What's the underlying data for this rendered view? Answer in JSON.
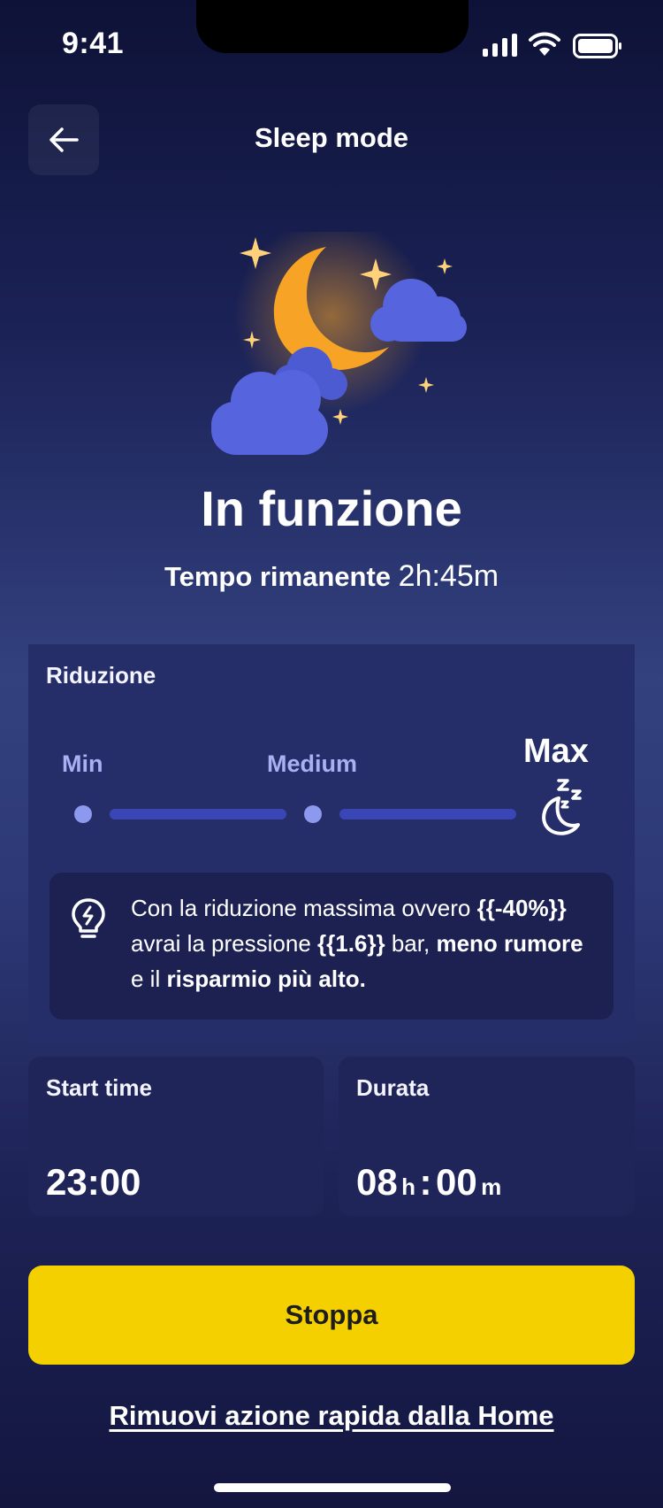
{
  "status_bar": {
    "time": "9:41"
  },
  "header": {
    "title": "Sleep mode"
  },
  "status": {
    "title": "In funzione",
    "remaining_label": "Tempo rimanente",
    "remaining_value": "2h:45m"
  },
  "reduction": {
    "label": "Riduzione",
    "levels": [
      "Min",
      "Medium",
      "Max"
    ],
    "selected_level": "Max",
    "tip": {
      "part1": "Con la riduzione massima ovvero ",
      "value1": "{{-40%}}",
      "part2": " avrai la pressione ",
      "value2": "{{1.6}}",
      "part3": " bar, ",
      "bold1": "meno rumore",
      "part4": " e il ",
      "bold2": "risparmio più alto."
    }
  },
  "start_time": {
    "label": "Start time",
    "value": "23:00"
  },
  "duration": {
    "label": "Durata",
    "hours": "08",
    "hours_unit": "h",
    "separator": ":",
    "minutes": "00",
    "minutes_unit": "m"
  },
  "actions": {
    "stop_label": "Stoppa",
    "remove_label": "Rimuovi azione rapida dalla Home"
  },
  "colors": {
    "accent_yellow": "#f5d000",
    "moon": "#f7a426",
    "cloud": "#5664de",
    "star": "#ffd27a",
    "track": "#3a46b5"
  },
  "icons": [
    "back-arrow-icon",
    "bulb-icon",
    "sleep-moon-icon",
    "signal-icon",
    "wifi-icon",
    "battery-icon"
  ]
}
